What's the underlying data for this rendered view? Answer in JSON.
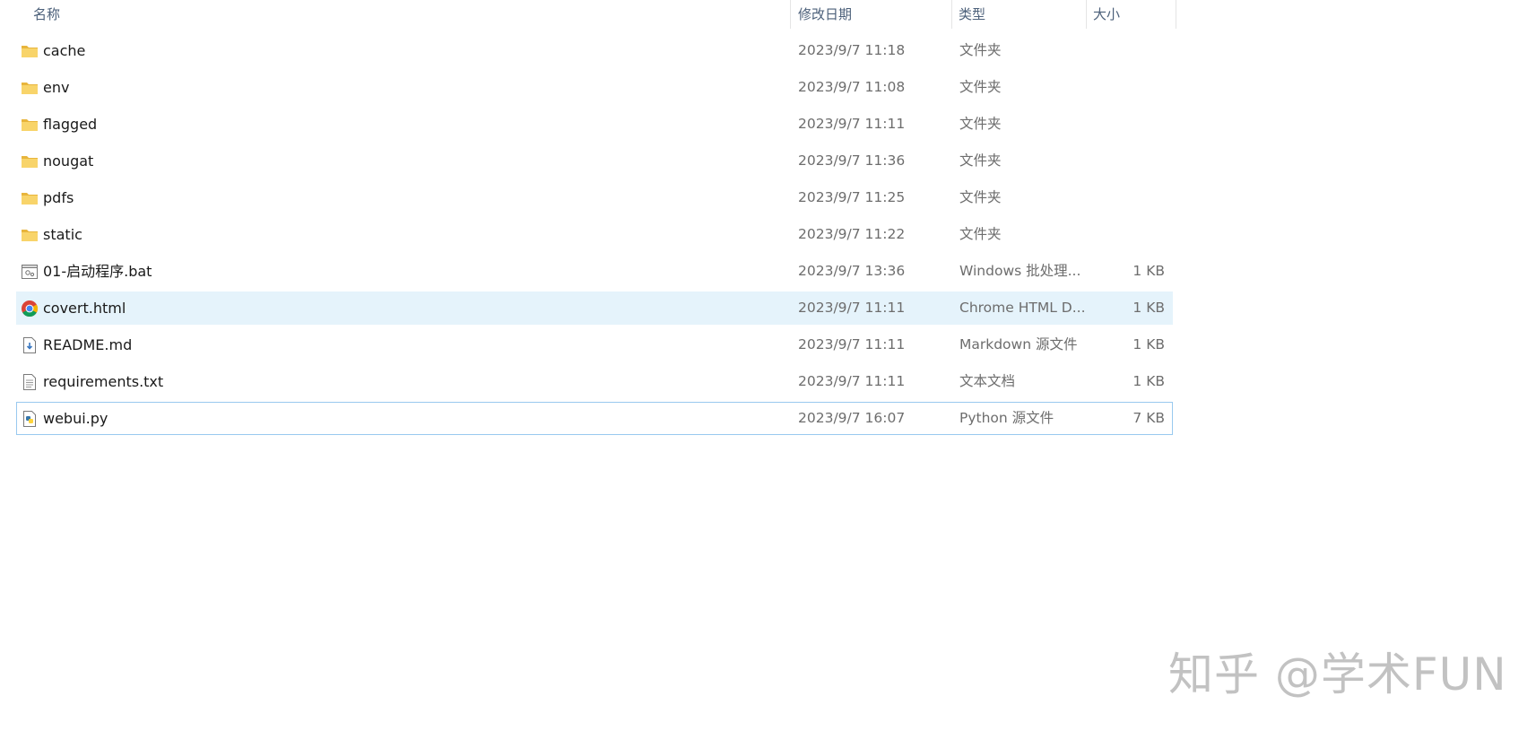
{
  "header": {
    "name": "名称",
    "date": "修改日期",
    "type": "类型",
    "size": "大小",
    "sort_indicator": "^"
  },
  "files": [
    {
      "name": "cache",
      "date": "2023/9/7 11:18",
      "type": "文件夹",
      "size": "",
      "icon": "folder-icon"
    },
    {
      "name": "env",
      "date": "2023/9/7 11:08",
      "type": "文件夹",
      "size": "",
      "icon": "folder-icon"
    },
    {
      "name": "flagged",
      "date": "2023/9/7 11:11",
      "type": "文件夹",
      "size": "",
      "icon": "folder-icon"
    },
    {
      "name": "nougat",
      "date": "2023/9/7 11:36",
      "type": "文件夹",
      "size": "",
      "icon": "folder-icon"
    },
    {
      "name": "pdfs",
      "date": "2023/9/7 11:25",
      "type": "文件夹",
      "size": "",
      "icon": "folder-icon"
    },
    {
      "name": "static",
      "date": "2023/9/7 11:22",
      "type": "文件夹",
      "size": "",
      "icon": "folder-icon"
    },
    {
      "name": "01-启动程序.bat",
      "date": "2023/9/7 13:36",
      "type": "Windows 批处理...",
      "size": "1 KB",
      "icon": "batch-file-icon"
    },
    {
      "name": "covert.html",
      "date": "2023/9/7 11:11",
      "type": "Chrome HTML D...",
      "size": "1 KB",
      "icon": "chrome-icon"
    },
    {
      "name": "README.md",
      "date": "2023/9/7 11:11",
      "type": "Markdown 源文件",
      "size": "1 KB",
      "icon": "markdown-file-icon"
    },
    {
      "name": "requirements.txt",
      "date": "2023/9/7 11:11",
      "type": "文本文档",
      "size": "1 KB",
      "icon": "text-file-icon"
    },
    {
      "name": "webui.py",
      "date": "2023/9/7 16:07",
      "type": "Python 源文件",
      "size": "7 KB",
      "icon": "python-file-icon"
    }
  ],
  "watermark": "知乎 @学术FUN",
  "colors": {
    "header_text": "#4c607a",
    "hover_bg": "#e5f3fb",
    "focus_border": "#99c9ef",
    "folder_yellow": "#f8d46a"
  }
}
